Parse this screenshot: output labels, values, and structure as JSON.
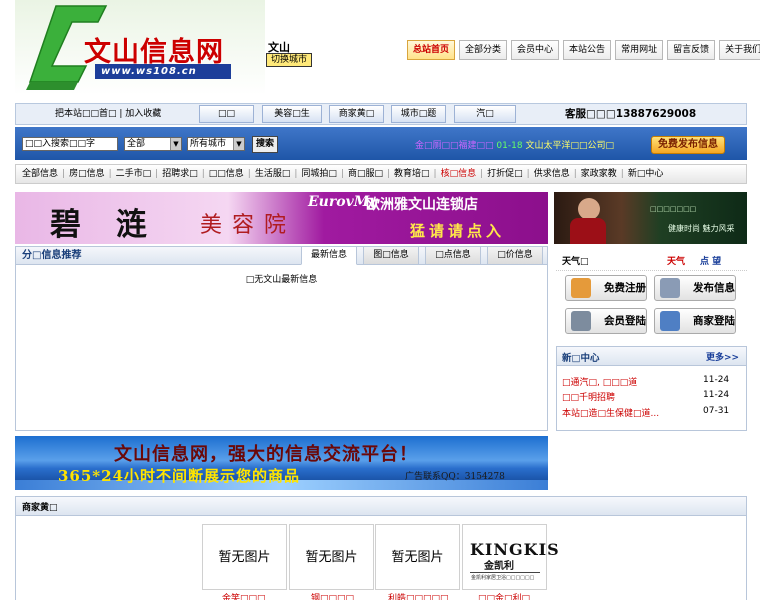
{
  "header": {
    "site_title": "文山信息网",
    "site_url": "www.ws108.cn",
    "city_name": "文山",
    "switch_city": "切换城市",
    "top_nav": [
      {
        "label": "总站首页",
        "active": true
      },
      {
        "label": "全部分类",
        "active": false
      },
      {
        "label": "会员中心",
        "active": false
      },
      {
        "label": "本站公告",
        "active": false
      },
      {
        "label": "常用网址",
        "active": false
      },
      {
        "label": "留言反馈",
        "active": false
      },
      {
        "label": "关于我们",
        "active": false
      }
    ]
  },
  "tabbar": {
    "bookmark_text": "把本站□□首□ | 加入收藏",
    "tabs": [
      "□□",
      "美容□生",
      "商家黄□",
      "城市□题",
      "汽□"
    ],
    "service": "客服□□□13887629008"
  },
  "search": {
    "placeholder": "□□入搜索□□字",
    "category": "全部",
    "city": "所有城市",
    "button": "搜索",
    "ticker_part1": "金□厕□□福建□□",
    "ticker_date": "01-18",
    "ticker_part2": "文山太平洋□□公司□",
    "post_button": "免费发布信息"
  },
  "categories": [
    {
      "label": "全部信息",
      "hl": false
    },
    {
      "label": "房□信息",
      "hl": false
    },
    {
      "label": "二手市□",
      "hl": false
    },
    {
      "label": "招聘求□",
      "hl": false
    },
    {
      "label": "□□信息",
      "hl": false
    },
    {
      "label": "生活服□",
      "hl": false
    },
    {
      "label": "同城拍□",
      "hl": false
    },
    {
      "label": "商□服□",
      "hl": false
    },
    {
      "label": "教育培□",
      "hl": false
    },
    {
      "label": "核□信息",
      "hl": true
    },
    {
      "label": "打折促□",
      "hl": false
    },
    {
      "label": "供求信息",
      "hl": false
    },
    {
      "label": "家政家教",
      "hl": false
    },
    {
      "label": "新□中心",
      "hl": false
    }
  ],
  "banner1": {
    "name": "碧  涟",
    "type": "美容院",
    "brand": "EurovMy",
    "slogan": "欧洲雅文山连锁店",
    "cta": "猛请请点入"
  },
  "side_ad": {
    "t1": "□□□□□□□",
    "t2": "健康时尚 魅力风采"
  },
  "recommend": {
    "title": "分□信息推荐",
    "tabs": [
      {
        "label": "最新信息",
        "active": true
      },
      {
        "label": "图□信息",
        "active": false
      },
      {
        "label": "□点信息",
        "active": false
      },
      {
        "label": "□价信息",
        "active": false
      }
    ],
    "empty_text": "□无文山最新信息"
  },
  "weather": {
    "label": "天气□",
    "value": "天气",
    "link": "点 望"
  },
  "quick_buttons": [
    {
      "label": "免费注册",
      "icon": "user-add-icon",
      "color": "#e59a3a"
    },
    {
      "label": "发布信息",
      "icon": "mail-icon",
      "color": "#8a9bb5"
    },
    {
      "label": "会员登陆",
      "icon": "key-icon",
      "color": "#7d8c9e"
    },
    {
      "label": "商家登陆",
      "icon": "shop-icon",
      "color": "#4f7fc4"
    }
  ],
  "news": {
    "title": "新□中心",
    "more": "更多>>",
    "items": [
      {
        "title": "□通汽□, □□□道",
        "date": "11-24"
      },
      {
        "title": "□□千明招聘",
        "date": "11-24"
      },
      {
        "title": "本站□造□生保健□道...",
        "date": "07-31"
      }
    ]
  },
  "banner2": {
    "headline": "文山信息网，强大的信息交流平台！",
    "line": "365*24小时不间断展示您的商品",
    "contact": "广告联系QQ：3154278"
  },
  "merchants": {
    "title": "商家黄□",
    "cards": [
      {
        "image_text": "暂无图片",
        "caption": "金笑□□□"
      },
      {
        "image_text": "暂无图片",
        "caption": "钢□□□□"
      },
      {
        "image_text": "暂无图片",
        "caption": "利皓□□□□□"
      }
    ],
    "brand_name": "KINGKIS",
    "brand_sub": "金凯利",
    "brand_tagline": "金凯利家居卫浴□□□□□□",
    "brand_caption": "□□金□利□"
  }
}
